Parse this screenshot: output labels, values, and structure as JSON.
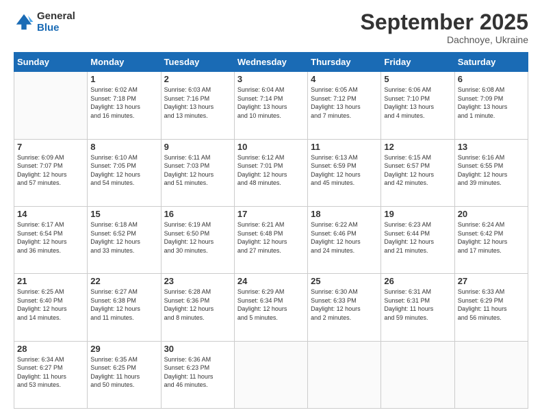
{
  "logo": {
    "line1": "General",
    "line2": "Blue"
  },
  "title": "September 2025",
  "subtitle": "Dachnoye, Ukraine",
  "days_header": [
    "Sunday",
    "Monday",
    "Tuesday",
    "Wednesday",
    "Thursday",
    "Friday",
    "Saturday"
  ],
  "weeks": [
    [
      {
        "day": "",
        "info": ""
      },
      {
        "day": "1",
        "info": "Sunrise: 6:02 AM\nSunset: 7:18 PM\nDaylight: 13 hours\nand 16 minutes."
      },
      {
        "day": "2",
        "info": "Sunrise: 6:03 AM\nSunset: 7:16 PM\nDaylight: 13 hours\nand 13 minutes."
      },
      {
        "day": "3",
        "info": "Sunrise: 6:04 AM\nSunset: 7:14 PM\nDaylight: 13 hours\nand 10 minutes."
      },
      {
        "day": "4",
        "info": "Sunrise: 6:05 AM\nSunset: 7:12 PM\nDaylight: 13 hours\nand 7 minutes."
      },
      {
        "day": "5",
        "info": "Sunrise: 6:06 AM\nSunset: 7:10 PM\nDaylight: 13 hours\nand 4 minutes."
      },
      {
        "day": "6",
        "info": "Sunrise: 6:08 AM\nSunset: 7:09 PM\nDaylight: 13 hours\nand 1 minute."
      }
    ],
    [
      {
        "day": "7",
        "info": "Sunrise: 6:09 AM\nSunset: 7:07 PM\nDaylight: 12 hours\nand 57 minutes."
      },
      {
        "day": "8",
        "info": "Sunrise: 6:10 AM\nSunset: 7:05 PM\nDaylight: 12 hours\nand 54 minutes."
      },
      {
        "day": "9",
        "info": "Sunrise: 6:11 AM\nSunset: 7:03 PM\nDaylight: 12 hours\nand 51 minutes."
      },
      {
        "day": "10",
        "info": "Sunrise: 6:12 AM\nSunset: 7:01 PM\nDaylight: 12 hours\nand 48 minutes."
      },
      {
        "day": "11",
        "info": "Sunrise: 6:13 AM\nSunset: 6:59 PM\nDaylight: 12 hours\nand 45 minutes."
      },
      {
        "day": "12",
        "info": "Sunrise: 6:15 AM\nSunset: 6:57 PM\nDaylight: 12 hours\nand 42 minutes."
      },
      {
        "day": "13",
        "info": "Sunrise: 6:16 AM\nSunset: 6:55 PM\nDaylight: 12 hours\nand 39 minutes."
      }
    ],
    [
      {
        "day": "14",
        "info": "Sunrise: 6:17 AM\nSunset: 6:54 PM\nDaylight: 12 hours\nand 36 minutes."
      },
      {
        "day": "15",
        "info": "Sunrise: 6:18 AM\nSunset: 6:52 PM\nDaylight: 12 hours\nand 33 minutes."
      },
      {
        "day": "16",
        "info": "Sunrise: 6:19 AM\nSunset: 6:50 PM\nDaylight: 12 hours\nand 30 minutes."
      },
      {
        "day": "17",
        "info": "Sunrise: 6:21 AM\nSunset: 6:48 PM\nDaylight: 12 hours\nand 27 minutes."
      },
      {
        "day": "18",
        "info": "Sunrise: 6:22 AM\nSunset: 6:46 PM\nDaylight: 12 hours\nand 24 minutes."
      },
      {
        "day": "19",
        "info": "Sunrise: 6:23 AM\nSunset: 6:44 PM\nDaylight: 12 hours\nand 21 minutes."
      },
      {
        "day": "20",
        "info": "Sunrise: 6:24 AM\nSunset: 6:42 PM\nDaylight: 12 hours\nand 17 minutes."
      }
    ],
    [
      {
        "day": "21",
        "info": "Sunrise: 6:25 AM\nSunset: 6:40 PM\nDaylight: 12 hours\nand 14 minutes."
      },
      {
        "day": "22",
        "info": "Sunrise: 6:27 AM\nSunset: 6:38 PM\nDaylight: 12 hours\nand 11 minutes."
      },
      {
        "day": "23",
        "info": "Sunrise: 6:28 AM\nSunset: 6:36 PM\nDaylight: 12 hours\nand 8 minutes."
      },
      {
        "day": "24",
        "info": "Sunrise: 6:29 AM\nSunset: 6:34 PM\nDaylight: 12 hours\nand 5 minutes."
      },
      {
        "day": "25",
        "info": "Sunrise: 6:30 AM\nSunset: 6:33 PM\nDaylight: 12 hours\nand 2 minutes."
      },
      {
        "day": "26",
        "info": "Sunrise: 6:31 AM\nSunset: 6:31 PM\nDaylight: 11 hours\nand 59 minutes."
      },
      {
        "day": "27",
        "info": "Sunrise: 6:33 AM\nSunset: 6:29 PM\nDaylight: 11 hours\nand 56 minutes."
      }
    ],
    [
      {
        "day": "28",
        "info": "Sunrise: 6:34 AM\nSunset: 6:27 PM\nDaylight: 11 hours\nand 53 minutes."
      },
      {
        "day": "29",
        "info": "Sunrise: 6:35 AM\nSunset: 6:25 PM\nDaylight: 11 hours\nand 50 minutes."
      },
      {
        "day": "30",
        "info": "Sunrise: 6:36 AM\nSunset: 6:23 PM\nDaylight: 11 hours\nand 46 minutes."
      },
      {
        "day": "",
        "info": ""
      },
      {
        "day": "",
        "info": ""
      },
      {
        "day": "",
        "info": ""
      },
      {
        "day": "",
        "info": ""
      }
    ]
  ]
}
